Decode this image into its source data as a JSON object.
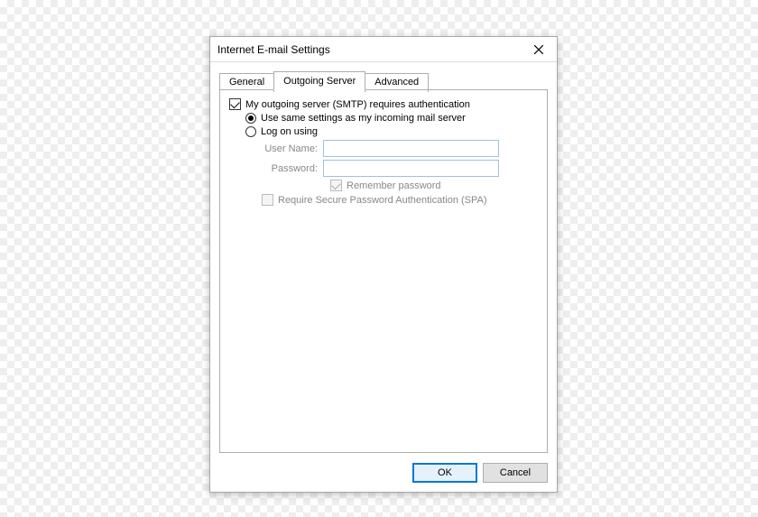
{
  "dialog": {
    "title": "Internet E-mail Settings"
  },
  "tabs": {
    "general": "General",
    "outgoing": "Outgoing Server",
    "advanced": "Advanced"
  },
  "form": {
    "requires_auth_label": "My outgoing server (SMTP) requires authentication",
    "requires_auth_checked": true,
    "use_same_label": "Use same settings as my incoming mail server",
    "use_same_selected": true,
    "logon_label": "Log on using",
    "logon_selected": false,
    "username_label": "User Name:",
    "username_value": "",
    "password_label": "Password:",
    "password_value": "",
    "remember_label": "Remember password",
    "remember_checked": true,
    "spa_label": "Require Secure Password Authentication (SPA)",
    "spa_checked": false
  },
  "buttons": {
    "ok": "OK",
    "cancel": "Cancel"
  }
}
